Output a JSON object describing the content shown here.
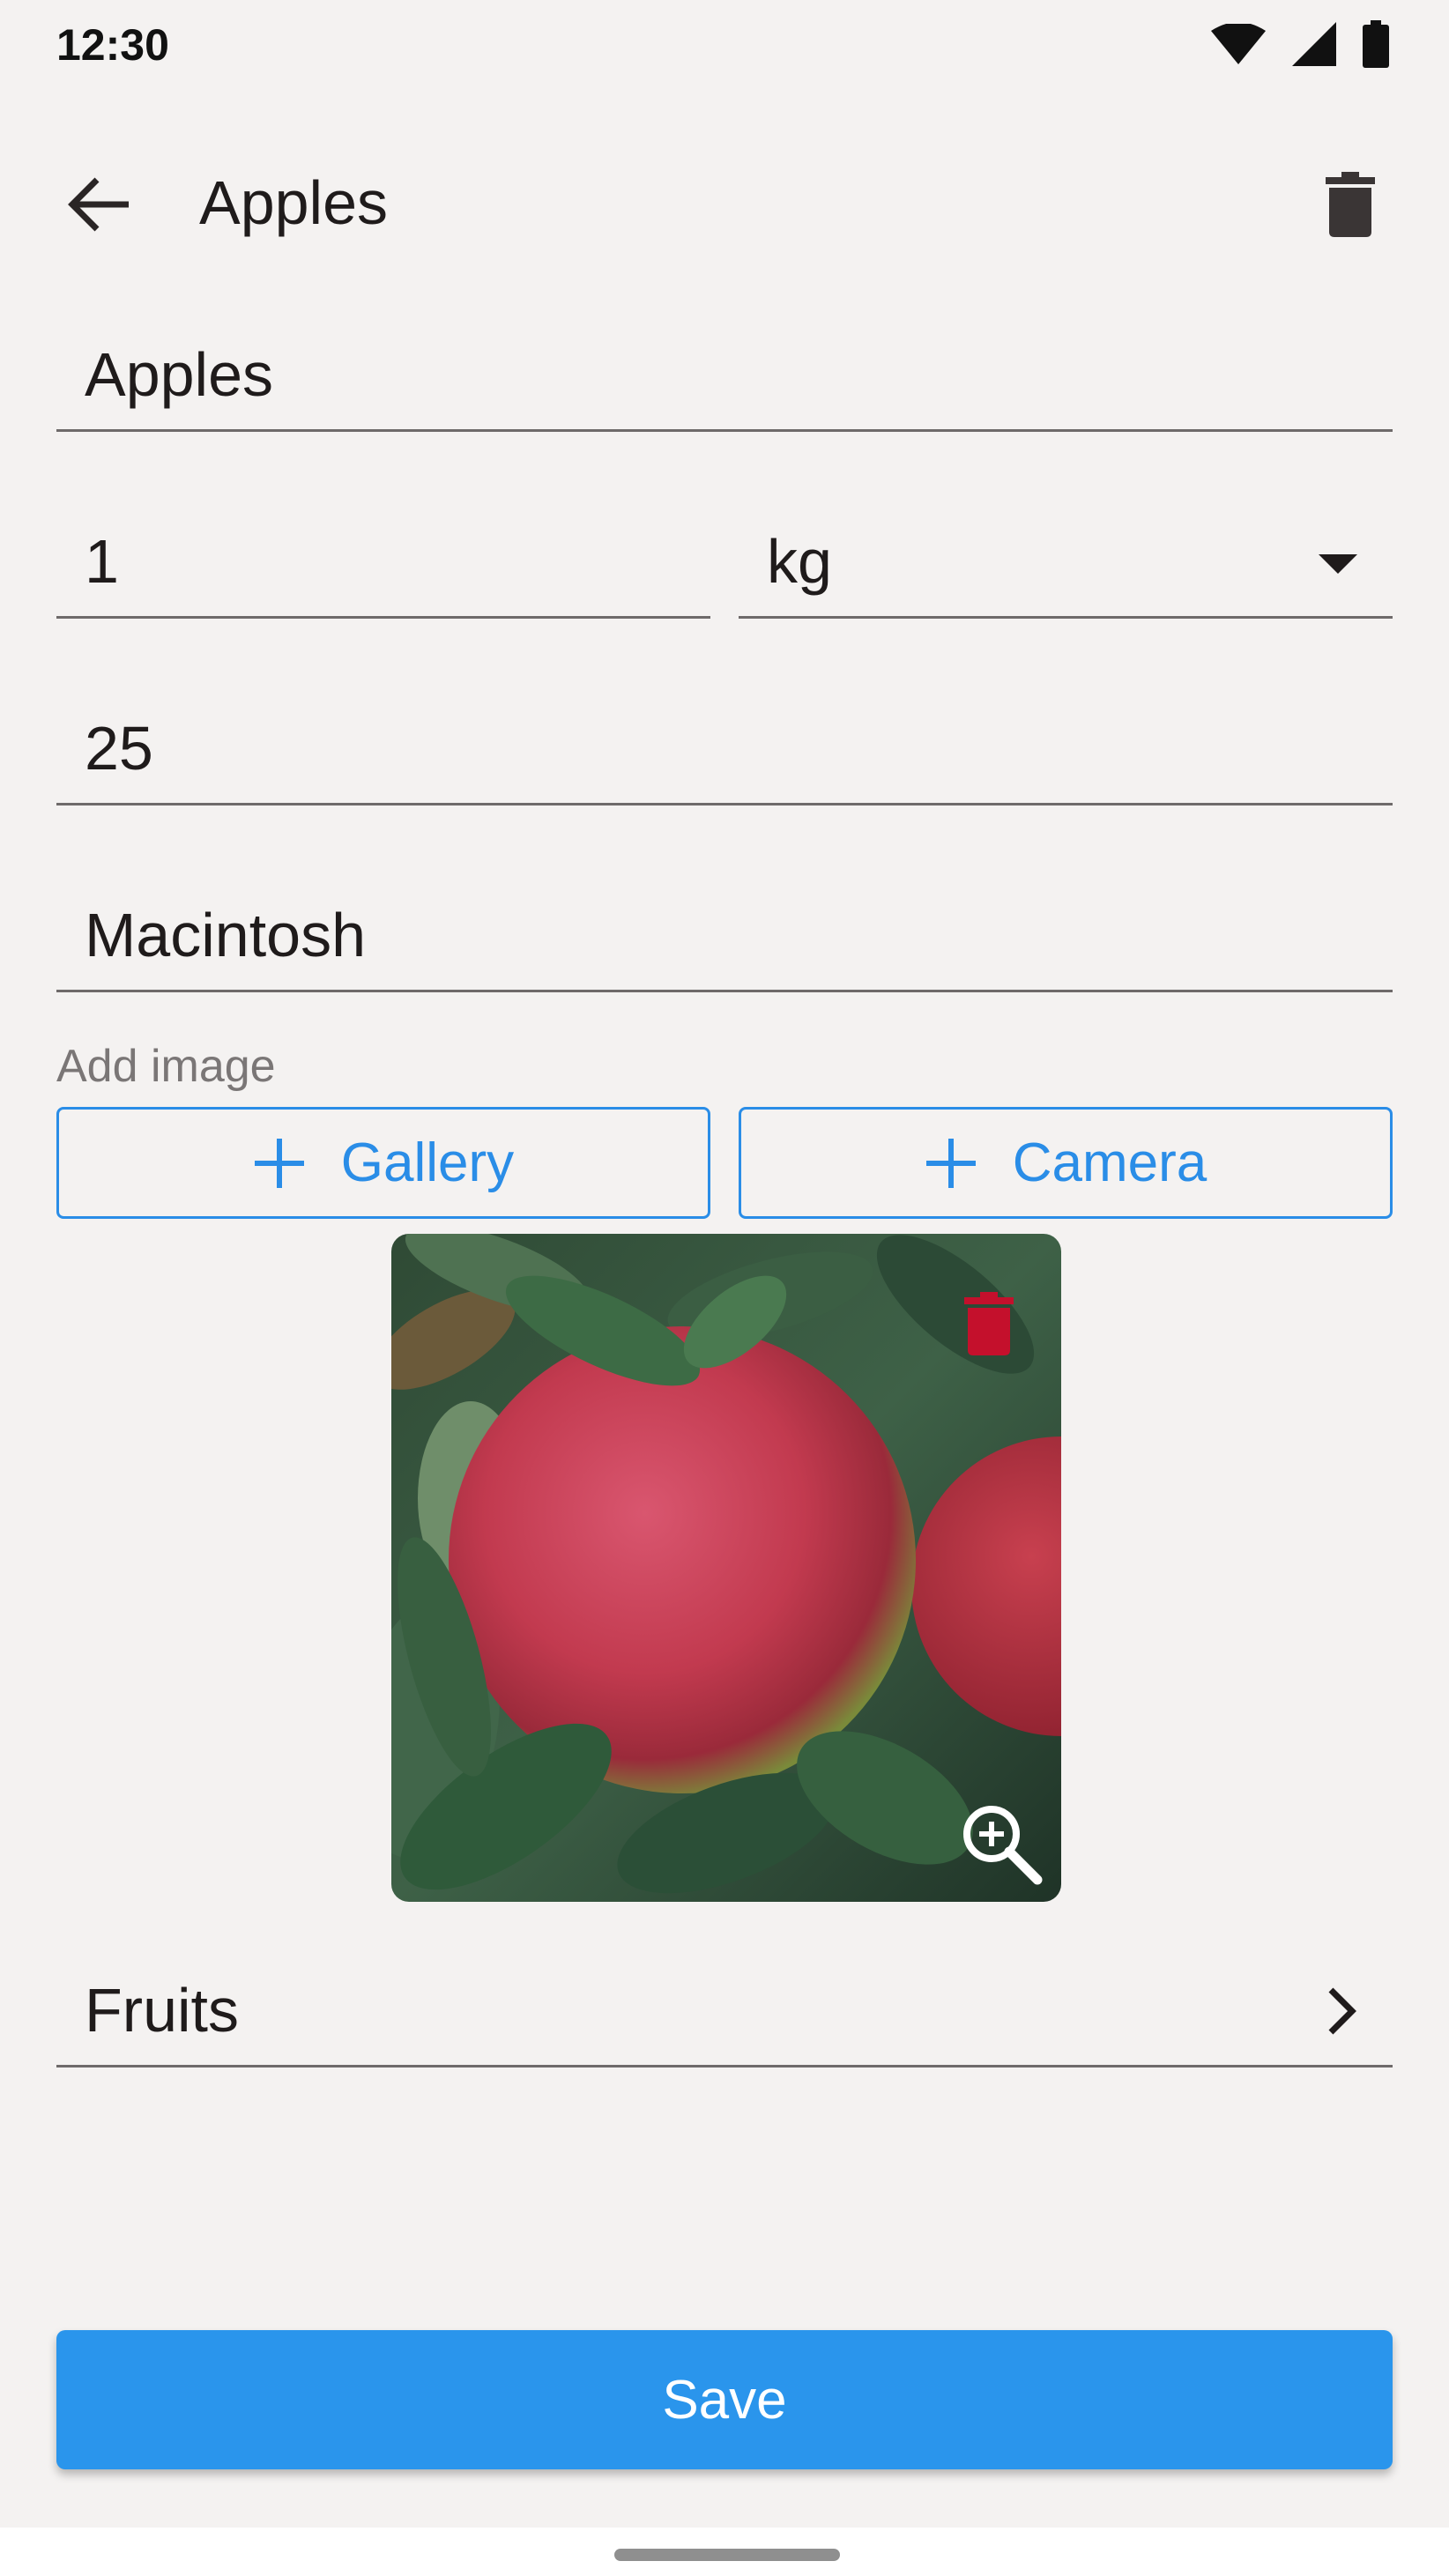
{
  "status_bar": {
    "time": "12:30",
    "icons": [
      "wifi-icon",
      "cellular-signal-icon",
      "battery-icon"
    ]
  },
  "app_bar": {
    "back_icon": "arrow-back-icon",
    "title": "Apples",
    "delete_icon": "trash-icon"
  },
  "form": {
    "name": {
      "value": "Apples"
    },
    "quantity": {
      "value": "1"
    },
    "unit": {
      "value": "kg",
      "icon": "dropdown-arrow-icon"
    },
    "price": {
      "value": "25"
    },
    "notes": {
      "value": "Macintosh"
    },
    "add_image_label": "Add image",
    "gallery_button": {
      "label": "Gallery",
      "icon": "plus-icon"
    },
    "camera_button": {
      "label": "Camera",
      "icon": "plus-icon"
    },
    "image": {
      "description": "apples-photo",
      "delete_icon": "trash-icon",
      "zoom_icon": "zoom-in-icon"
    },
    "category": {
      "value": "Fruits",
      "icon": "chevron-right-icon"
    }
  },
  "save_button": {
    "label": "Save"
  },
  "colors": {
    "background": "#f4f2f1",
    "accent": "#2a8de7",
    "save_button": "#2a95ec",
    "image_delete": "#c4102c"
  }
}
